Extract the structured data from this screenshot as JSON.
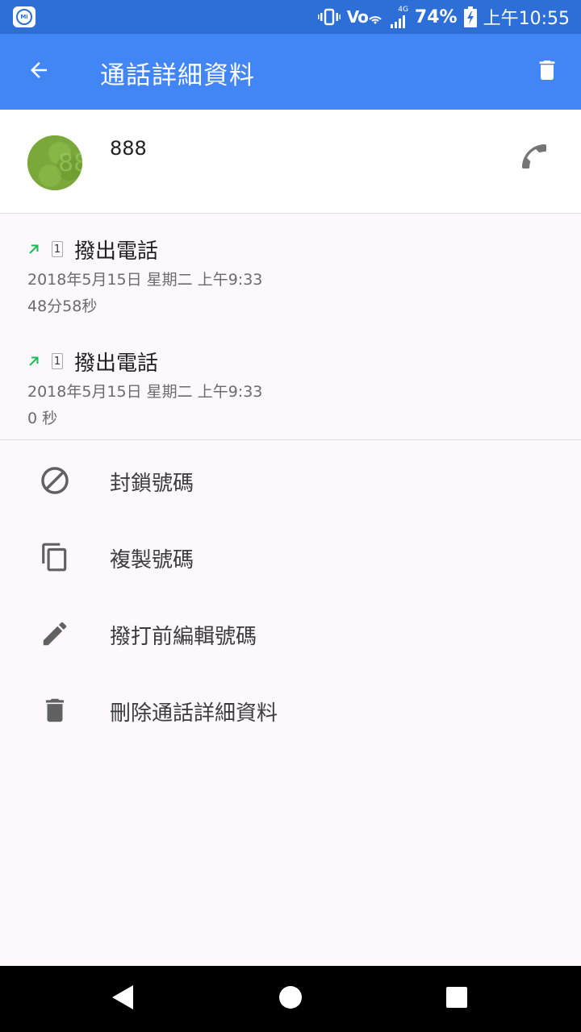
{
  "status_bar": {
    "battery": "74%",
    "time": "上午10:55",
    "network": "4G",
    "volte": "Vo",
    "icons": [
      "vibrate-icon",
      "volte-icon",
      "signal-icon",
      "battery-charging-icon"
    ]
  },
  "app_bar": {
    "title": "通話詳細資料",
    "back_icon": "arrow-back-icon",
    "delete_icon": "trash-icon",
    "color": "#4285f4"
  },
  "contact": {
    "number": "888",
    "call_icon": "phone-icon",
    "avatar_color": "#7aa83a"
  },
  "calls": [
    {
      "sim": "1",
      "type": "撥出電話",
      "date": "2018年5月15日 星期二 上午9:33",
      "duration": "48分58秒",
      "direction_icon": "outgoing-arrow-icon"
    },
    {
      "sim": "1",
      "type": "撥出電話",
      "date": "2018年5月15日 星期二 上午9:33",
      "duration": "0 秒",
      "direction_icon": "outgoing-arrow-icon"
    }
  ],
  "actions": [
    {
      "label": "封鎖號碼",
      "icon": "block-icon"
    },
    {
      "label": "複製號碼",
      "icon": "copy-icon"
    },
    {
      "label": "撥打前編輯號碼",
      "icon": "pencil-icon"
    },
    {
      "label": "刪除通話詳細資料",
      "icon": "trash-icon"
    }
  ],
  "nav": {
    "back_icon": "nav-back-icon",
    "home_icon": "nav-home-icon",
    "recents_icon": "nav-recents-icon"
  }
}
